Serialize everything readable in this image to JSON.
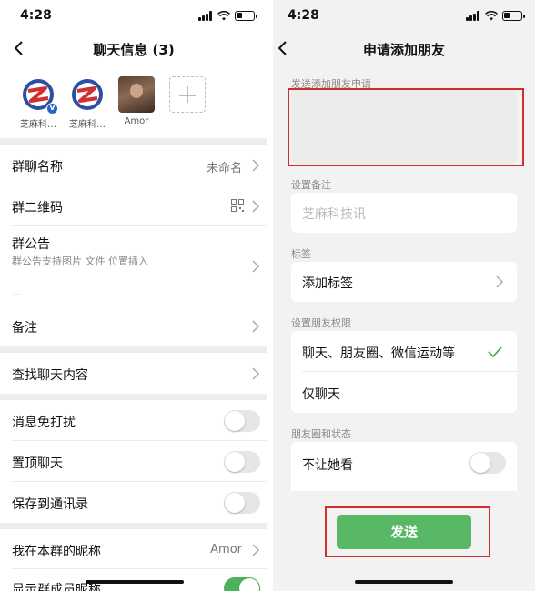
{
  "left": {
    "status": {
      "time": "4:28"
    },
    "title": "聊天信息 (3)",
    "members": [
      {
        "name": "芝麻科…"
      },
      {
        "name": "芝麻科…"
      },
      {
        "name": "Amor"
      }
    ],
    "rows": {
      "group_name": {
        "label": "群聊名称",
        "value": "未命名"
      },
      "qr_code": {
        "label": "群二维码"
      },
      "notice": {
        "label": "群公告",
        "sub": "群公告支持图片 文件 位置插入",
        "ellipsis": "..."
      },
      "remark": {
        "label": "备注"
      },
      "search": {
        "label": "查找聊天内容"
      },
      "mute": {
        "label": "消息免打扰",
        "on": false
      },
      "pin": {
        "label": "置顶聊天",
        "on": false
      },
      "save": {
        "label": "保存到通讯录",
        "on": false
      },
      "nickname": {
        "label": "我在本群的昵称",
        "value": "Amor"
      },
      "show_nick": {
        "label": "显示群成员昵称",
        "on": true
      }
    }
  },
  "right": {
    "status": {
      "time": "4:28"
    },
    "title": "申请添加朋友",
    "request_label": "发送添加朋友申请",
    "request_value": "",
    "remark_label": "设置备注",
    "remark_placeholder": "芝麻科技讯",
    "tag_label": "标签",
    "tag_action": "添加标签",
    "permission_label": "设置朋友权限",
    "permission_options": [
      {
        "label": "聊天、朋友圈、微信运动等",
        "selected": true
      },
      {
        "label": "仅聊天",
        "selected": false
      }
    ],
    "moments_label": "朋友圈和状态",
    "moments_option": {
      "label": "不让她看",
      "on": false
    },
    "send_button": "发送"
  },
  "colors": {
    "accent_green": "#59b865",
    "highlight_red": "#d22d2d"
  }
}
